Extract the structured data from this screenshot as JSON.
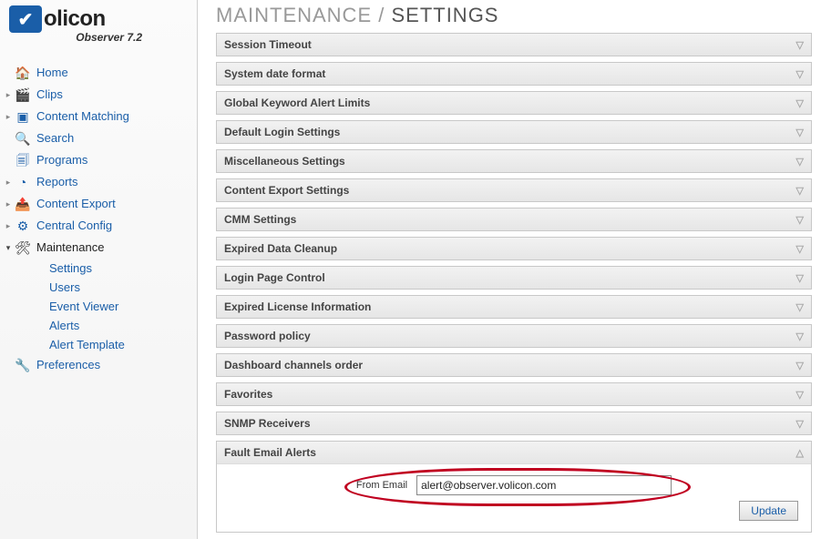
{
  "logo": {
    "brand": "olicon",
    "sub": "Observer 7.2"
  },
  "nav": {
    "home": "Home",
    "clips": "Clips",
    "contentMatching": "Content Matching",
    "search": "Search",
    "programs": "Programs",
    "reports": "Reports",
    "contentExport": "Content Export",
    "centralConfig": "Central Config",
    "maintenance": "Maintenance",
    "maintenanceSub": {
      "settings": "Settings",
      "users": "Users",
      "eventViewer": "Event Viewer",
      "alerts": "Alerts",
      "alertTemplate": "Alert Template"
    },
    "preferences": "Preferences"
  },
  "header": {
    "breadcrumb1": "MAINTENANCE",
    "sep": " / ",
    "breadcrumb2": "SETTINGS"
  },
  "panels": {
    "sessionTimeout": "Session Timeout",
    "systemDateFormat": "System date format",
    "globalKeyword": "Global Keyword Alert Limits",
    "defaultLogin": "Default Login Settings",
    "misc": "Miscellaneous Settings",
    "contentExport": "Content Export Settings",
    "cmm": "CMM Settings",
    "expiredData": "Expired Data Cleanup",
    "loginPage": "Login Page Control",
    "expiredLicense": "Expired License Information",
    "passwordPolicy": "Password policy",
    "dashboardChannels": "Dashboard channels order",
    "favorites": "Favorites",
    "snmp": "SNMP Receivers",
    "faultEmail": "Fault Email Alerts"
  },
  "faultEmail": {
    "label": "From Email",
    "value": "alert@observer.volicon.com"
  },
  "buttons": {
    "update": "Update"
  }
}
